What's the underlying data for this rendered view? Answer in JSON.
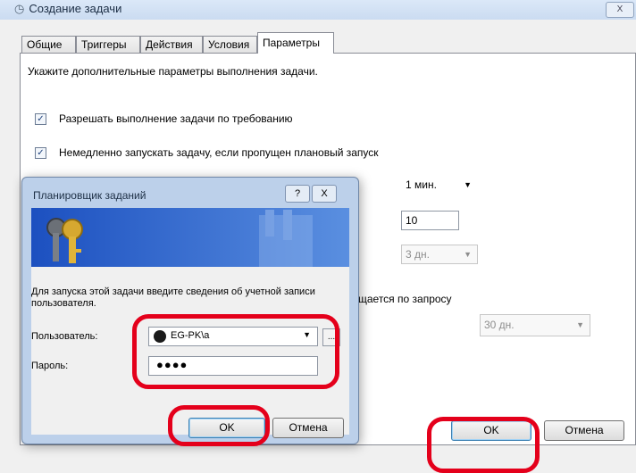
{
  "window": {
    "title": "Создание задачи",
    "close_label": "X"
  },
  "tabs": [
    "Общие",
    "Триггеры",
    "Действия",
    "Условия",
    "Параметры"
  ],
  "active_tab": "Параметры",
  "panel": {
    "description": "Укажите дополнительные параметры выполнения задачи.",
    "check_on_demand": "Разрешать выполнение задачи по требованию",
    "check_run_missed": "Немедленно запускать задачу, если пропущен плановый запуск",
    "combo_restart_interval": "1 мин.",
    "input_attempts": "10",
    "combo_stop_after": "3 дн.",
    "partial_text": "щается по запросу",
    "combo_delete_after": "30 дн."
  },
  "buttons": {
    "ok": "OK",
    "cancel": "Отмена"
  },
  "dialog": {
    "title": "Планировщик заданий",
    "help_label": "?",
    "close_label": "X",
    "prompt": "Для запуска этой задачи введите сведения об учетной записи пользователя.",
    "user_label": "Пользователь:",
    "user_value": "EG-PK\\a",
    "browse_label": "...",
    "password_label": "Пароль:",
    "password_mask": "●●●●",
    "ok": "OK",
    "cancel": "Отмена"
  },
  "check_mark": "✓",
  "dropdown_arrow": "▼",
  "colors": {
    "highlight_ring": "#e4001b",
    "dialog_frame": "#bcd0ea",
    "banner_blue": "#3a6fd0"
  }
}
